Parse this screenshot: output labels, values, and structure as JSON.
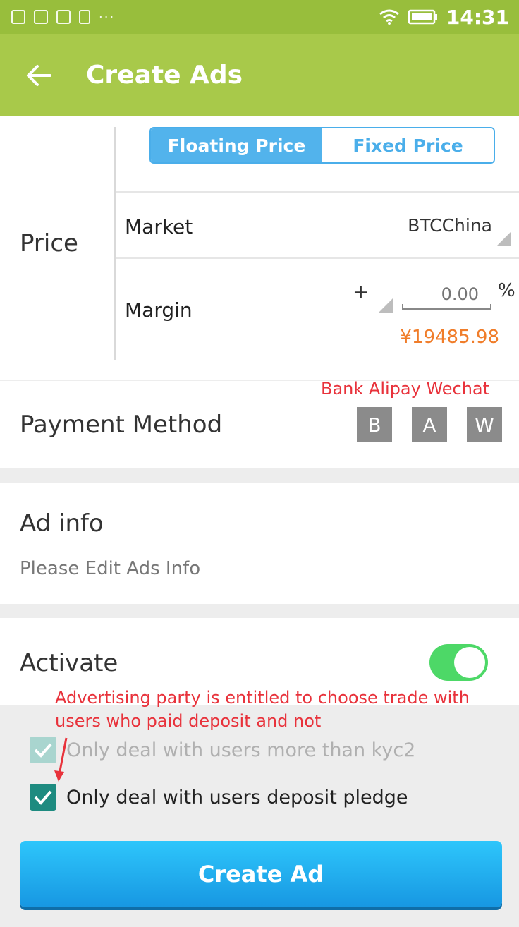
{
  "status_bar": {
    "time": "14:31",
    "icons": [
      "image-icon",
      "app-icon",
      "gallery-icon",
      "sim-icon",
      "wifi-icon",
      "battery-icon"
    ],
    "more_indicator": "···"
  },
  "app_bar": {
    "title": "Create Ads",
    "back_icon": "arrow-left-icon",
    "background": "#a8c94a"
  },
  "price": {
    "label": "Price",
    "tabs": [
      {
        "label": "Floating Price",
        "selected": true
      },
      {
        "label": "Fixed Price",
        "selected": false
      }
    ],
    "market": {
      "label": "Market",
      "value": "BTCChina"
    },
    "margin": {
      "label": "Margin",
      "sign": "+",
      "placeholder": "0.00",
      "unit": "%",
      "calculated_price": "¥19485.98"
    }
  },
  "payment": {
    "label": "Payment Method",
    "annotation": "Bank Alipay Wechat",
    "methods": [
      "B",
      "A",
      "W"
    ]
  },
  "ad_info": {
    "title": "Ad info",
    "placeholder": "Please Edit Ads Info"
  },
  "activate": {
    "label": "Activate",
    "enabled": true
  },
  "annotation_deposit": {
    "line1": "Advertising party is entitled to choose trade with",
    "line2": "users who paid deposit and not"
  },
  "options": [
    {
      "label": "Only deal with users more than kyc2",
      "checked": true,
      "disabled": true
    },
    {
      "label": "Only deal with users deposit pledge",
      "checked": true,
      "disabled": false
    }
  ],
  "create_button": {
    "label": "Create Ad"
  },
  "colors": {
    "accent": "#a8c94a",
    "primary_button": "#1fa9ef",
    "toggle_on": "#4dd867",
    "price_text": "#f07d2a",
    "annotation": "#e8323b",
    "checkbox": "#1e8b80"
  }
}
